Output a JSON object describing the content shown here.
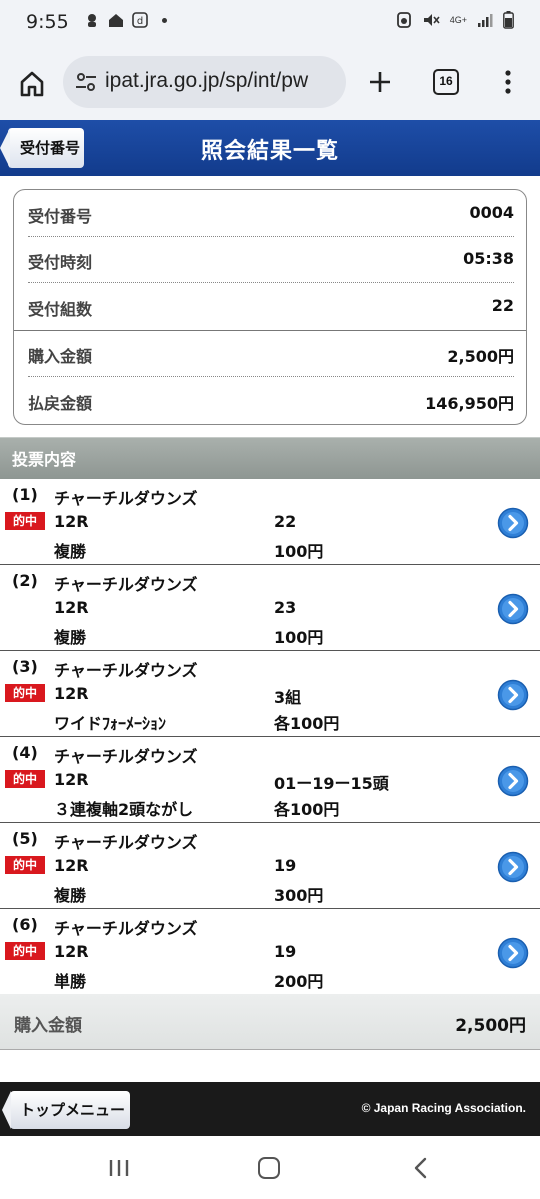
{
  "status_bar": {
    "time": "9:55",
    "network": "4G+"
  },
  "browser": {
    "url": "ipat.jra.go.jp/sp/int/pw",
    "tab_count": "16"
  },
  "header": {
    "back_label": "受付番号",
    "title": "照会結果一覧"
  },
  "summary": {
    "rows": [
      {
        "label": "受付番号",
        "value": "0004"
      },
      {
        "label": "受付時刻",
        "value": "05:38"
      },
      {
        "label": "受付組数",
        "value": "22"
      },
      {
        "label": "購入金額",
        "value": "2,500円"
      },
      {
        "label": "払戻金額",
        "value": "146,950円"
      }
    ]
  },
  "section": {
    "title": "投票内容"
  },
  "bets": [
    {
      "num": "(1)",
      "venue": "チャーチルダウンズ",
      "hit": true,
      "hit_label": "的中",
      "race": "12R",
      "combo": "22",
      "type": "複勝",
      "amount": "100円"
    },
    {
      "num": "(2)",
      "venue": "チャーチルダウンズ",
      "hit": false,
      "hit_label": "",
      "race": "12R",
      "combo": "23",
      "type": "複勝",
      "amount": "100円"
    },
    {
      "num": "(3)",
      "venue": "チャーチルダウンズ",
      "hit": true,
      "hit_label": "的中",
      "race": "12R",
      "combo": "3組",
      "type": "ワイドﾌｫｰﾒｰｼｮﾝ",
      "amount": "各100円"
    },
    {
      "num": "(4)",
      "venue": "チャーチルダウンズ",
      "hit": true,
      "hit_label": "的中",
      "race": "12R",
      "combo": "01ー19ー15頭",
      "type": "３連複軸2頭ながし",
      "amount": "各100円"
    },
    {
      "num": "(5)",
      "venue": "チャーチルダウンズ",
      "hit": true,
      "hit_label": "的中",
      "race": "12R",
      "combo": "19",
      "type": "複勝",
      "amount": "300円"
    },
    {
      "num": "(6)",
      "venue": "チャーチルダウンズ",
      "hit": true,
      "hit_label": "的中",
      "race": "12R",
      "combo": "19",
      "type": "単勝",
      "amount": "200円"
    }
  ],
  "total": {
    "label": "購入金額",
    "value": "2,500円"
  },
  "footer": {
    "top_menu_label": "トップメニュー",
    "copyright": "© Japan Racing Association."
  },
  "colors": {
    "header_blue": "#1a469c",
    "hit_red": "#d9181e",
    "detail_blue": "#2f7fd6"
  }
}
